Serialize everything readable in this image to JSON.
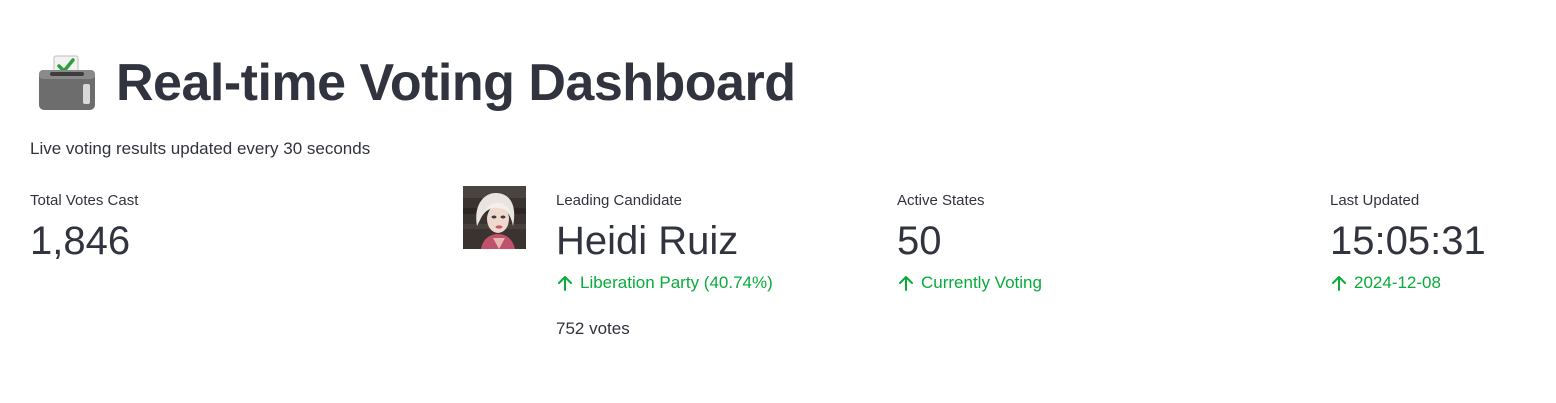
{
  "header": {
    "icon": "ballot-box-icon",
    "title": "Real-time Voting Dashboard",
    "subtitle": "Live voting results updated every 30 seconds"
  },
  "metrics": {
    "total_votes": {
      "label": "Total Votes Cast",
      "value": "1,846"
    },
    "leading_candidate": {
      "avatar": "candidate-photo",
      "label": "Leading Candidate",
      "value": "Heidi Ruiz",
      "delta": "Liberation Party (40.74%)",
      "votes": "752 votes"
    },
    "active_states": {
      "label": "Active States",
      "value": "50",
      "delta": "Currently Voting"
    },
    "last_updated": {
      "label": "Last Updated",
      "value": "15:05:31",
      "delta": "2024-12-08"
    }
  },
  "colors": {
    "text": "#31333f",
    "delta_positive": "#09ab3b",
    "background": "#ffffff"
  }
}
